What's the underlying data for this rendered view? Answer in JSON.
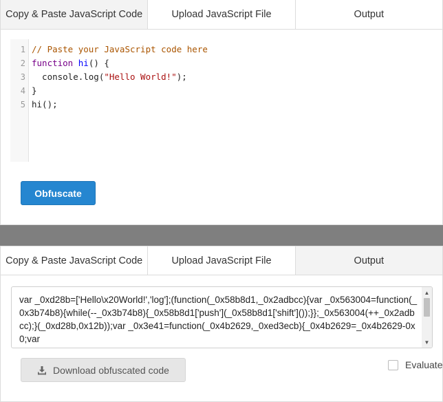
{
  "top_panel": {
    "tabs": [
      {
        "label": "Copy & Paste JavaScript Code",
        "active": true
      },
      {
        "label": "Upload JavaScript File",
        "active": false
      },
      {
        "label": "Output",
        "active": false
      }
    ],
    "editor": {
      "line_numbers": [
        "1",
        "2",
        "3",
        "4",
        "5"
      ],
      "lines": {
        "l1_comment": "// Paste your JavaScript code here",
        "l2_kw": "function",
        "l2_fn": "hi",
        "l2_rest": "() {",
        "l3_pre": "  console.log(",
        "l3_str": "\"Hello World!\"",
        "l3_post": ");",
        "l4": "}",
        "l5": "hi();"
      }
    },
    "obfuscate_label": "Obfuscate"
  },
  "bottom_panel": {
    "tabs": [
      {
        "label": "Copy & Paste JavaScript Code",
        "active": false
      },
      {
        "label": "Upload JavaScript File",
        "active": false
      },
      {
        "label": "Output",
        "active": true
      }
    ],
    "output_text": "var _0xd28b=['Hello\\x20World!','log'];(function(_0x58b8d1,_0x2adbcc){var _0x563004=function(_0x3b74b8){while(--_0x3b74b8){_0x58b8d1['push'](_0x58b8d1['shift']());}};_0x563004(++_0x2adbcc);}(_0xd28b,0x12b));var _0x3e41=function(_0x4b2629,_0xed3ecb){_0x4b2629=_0x4b2629-0x0;var",
    "download_label": "Download obfuscated code",
    "evaluate_label": "Evaluate"
  },
  "colors": {
    "primary_button": "#2586d0",
    "divider": "#7f7f7f",
    "active_tab": "#f3f3f3"
  },
  "icons": {
    "download": "download-icon",
    "scroll_up": "scroll-up-arrow-icon",
    "scroll_down": "scroll-down-arrow-icon"
  }
}
